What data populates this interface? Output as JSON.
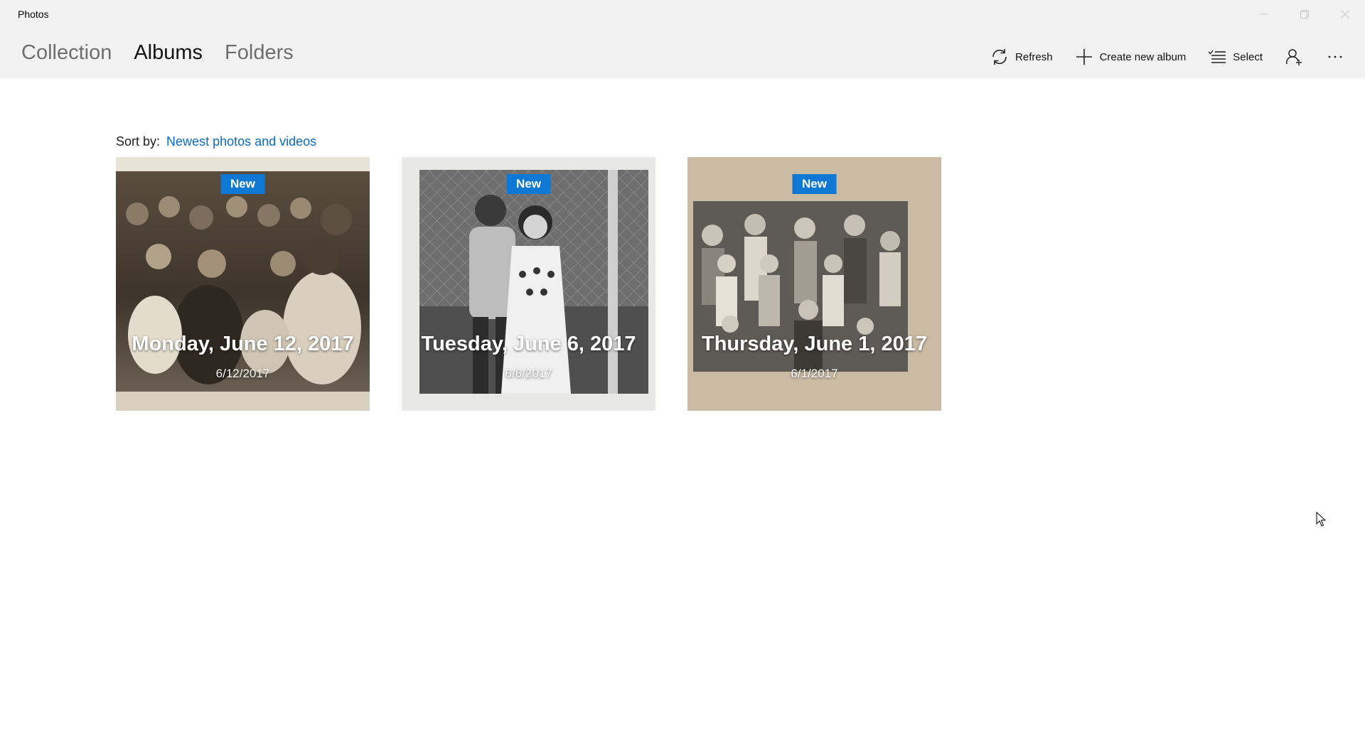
{
  "window": {
    "title": "Photos"
  },
  "nav": {
    "tabs": [
      {
        "label": "Collection",
        "active": false
      },
      {
        "label": "Albums",
        "active": true
      },
      {
        "label": "Folders",
        "active": false
      }
    ]
  },
  "commands": {
    "refresh": {
      "label": "Refresh",
      "icon": "refresh-icon"
    },
    "create_album": {
      "label": "Create new album",
      "icon": "plus-icon"
    },
    "select": {
      "label": "Select",
      "icon": "select-list-icon"
    },
    "account": {
      "icon": "person-add-icon"
    },
    "more": {
      "icon": "more-icon"
    }
  },
  "sort": {
    "label": "Sort by:",
    "value": "Newest photos and videos"
  },
  "albums": [
    {
      "title": "Monday, June 12, 2017",
      "date": "6/12/2017",
      "badge": "New"
    },
    {
      "title": "Tuesday, June 6, 2017",
      "date": "6/6/2017",
      "badge": "New"
    },
    {
      "title": "Thursday, June 1, 2017",
      "date": "6/1/2017",
      "badge": "New"
    }
  ],
  "colors": {
    "accent": "#0f78d4",
    "link": "#0b6ac4",
    "chrome": "#f2f2f2"
  }
}
